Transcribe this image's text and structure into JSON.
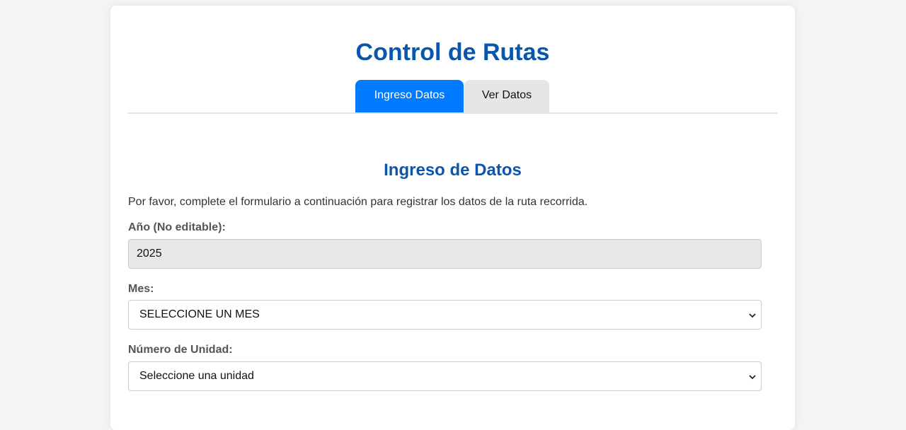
{
  "header": {
    "title": "Control de Rutas"
  },
  "tabs": [
    {
      "label": "Ingreso Datos",
      "active": true
    },
    {
      "label": "Ver Datos",
      "active": false
    }
  ],
  "form": {
    "section_title": "Ingreso de Datos",
    "intro": "Por favor, complete el formulario a continuación para registrar los datos de la ruta recorrida.",
    "year": {
      "label": "Año (No editable):",
      "value": "2025"
    },
    "month": {
      "label": "Mes:",
      "selected": "SELECCIONE UN MES"
    },
    "unit": {
      "label": "Número de Unidad:",
      "selected": "Seleccione una unidad"
    }
  },
  "colors": {
    "accent": "#007bff",
    "title": "#0a56ad",
    "background": "#f4f4f4"
  },
  "icons": {
    "select_arrow": "chevron-down-icon"
  }
}
